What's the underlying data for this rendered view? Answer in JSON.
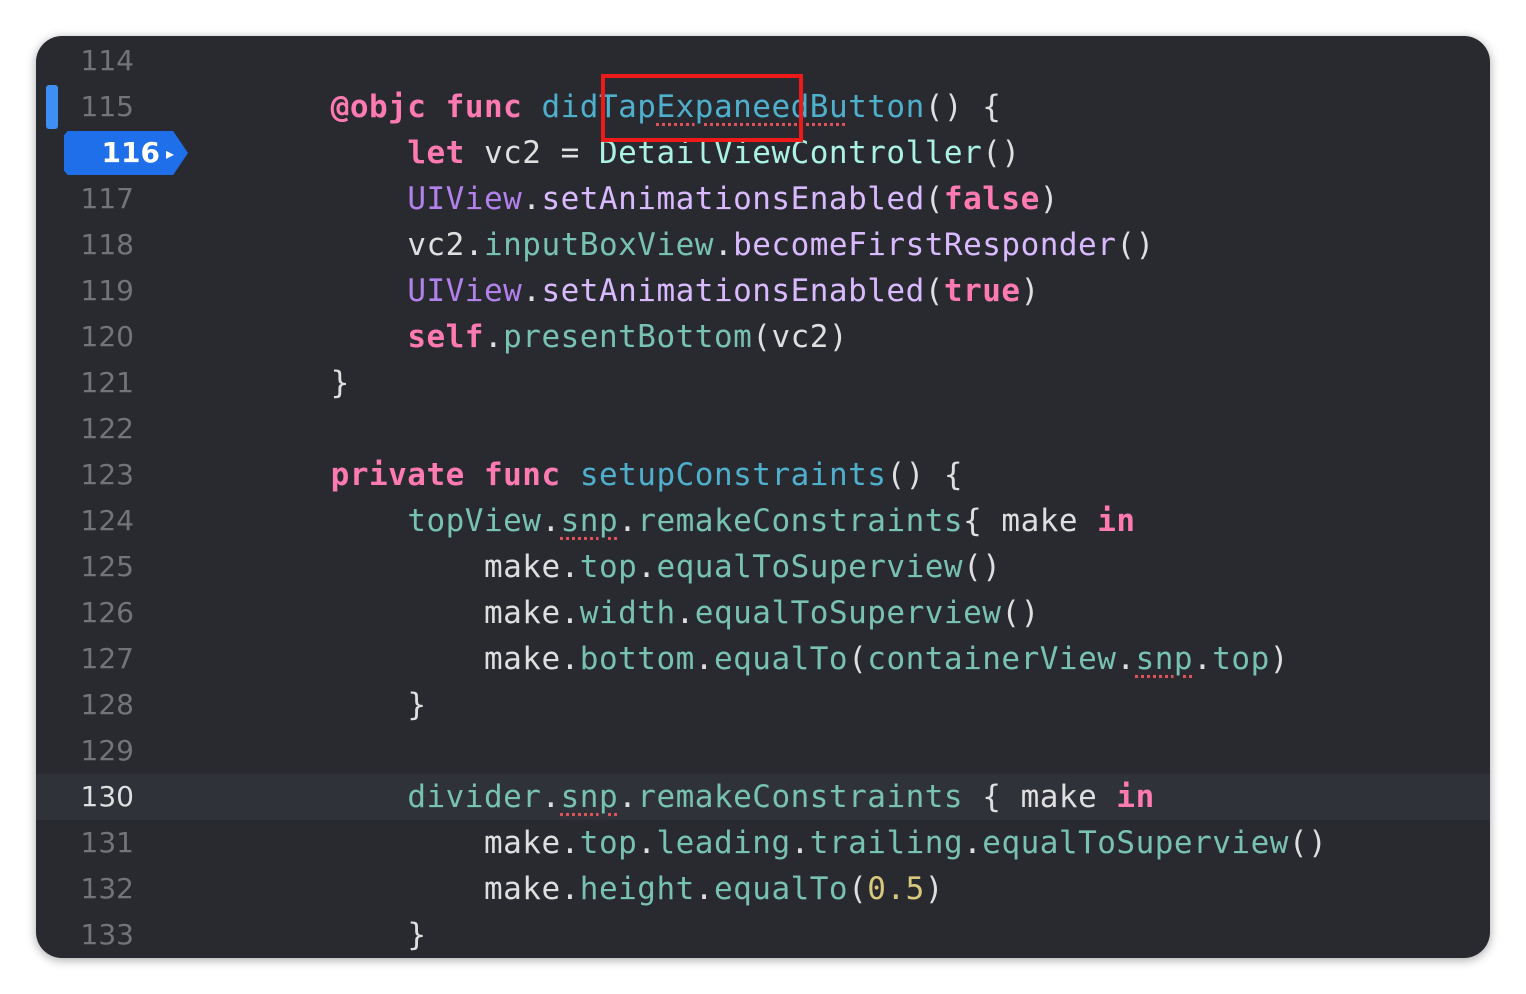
{
  "editor": {
    "current_line": 130,
    "breakpoint": {
      "line": "116",
      "arrow": "▸"
    },
    "lines": [
      {
        "n": "114",
        "tokens": []
      },
      {
        "n": "115",
        "indent": "    ",
        "tokens": [
          [
            "kw",
            "@objc"
          ],
          [
            "plain",
            " "
          ],
          [
            "kw",
            "func"
          ],
          [
            "plain",
            " "
          ],
          [
            "decl",
            "didTapExpaneedButton",
            "warn-part"
          ],
          [
            "plain",
            "() {"
          ]
        ]
      },
      {
        "n": "116",
        "indent": "        ",
        "tokens": [
          [
            "kw",
            "let"
          ],
          [
            "plain",
            " vc2 = "
          ],
          [
            "typ",
            "DetailViewController"
          ],
          [
            "plain",
            "()"
          ]
        ]
      },
      {
        "n": "117",
        "indent": "        ",
        "tokens": [
          [
            "ctype",
            "UIView"
          ],
          [
            "plain",
            "."
          ],
          [
            "cls",
            "setAnimationsEnabled"
          ],
          [
            "plain",
            "("
          ],
          [
            "kw",
            "false"
          ],
          [
            "plain",
            ")"
          ]
        ]
      },
      {
        "n": "118",
        "indent": "        ",
        "tokens": [
          [
            "plain",
            "vc2."
          ],
          [
            "mem",
            "inputBoxView"
          ],
          [
            "plain",
            "."
          ],
          [
            "cls",
            "becomeFirstResponder"
          ],
          [
            "plain",
            "()"
          ]
        ]
      },
      {
        "n": "119",
        "indent": "        ",
        "tokens": [
          [
            "ctype",
            "UIView"
          ],
          [
            "plain",
            "."
          ],
          [
            "cls",
            "setAnimationsEnabled"
          ],
          [
            "plain",
            "("
          ],
          [
            "kw",
            "true"
          ],
          [
            "plain",
            ")"
          ]
        ]
      },
      {
        "n": "120",
        "indent": "        ",
        "tokens": [
          [
            "kw",
            "self"
          ],
          [
            "plain",
            "."
          ],
          [
            "mem",
            "presentBottom"
          ],
          [
            "plain",
            "(vc2)"
          ]
        ]
      },
      {
        "n": "121",
        "indent": "    ",
        "tokens": [
          [
            "plain",
            "}"
          ]
        ]
      },
      {
        "n": "122",
        "tokens": []
      },
      {
        "n": "123",
        "indent": "    ",
        "tokens": [
          [
            "kw",
            "private"
          ],
          [
            "plain",
            " "
          ],
          [
            "kw",
            "func"
          ],
          [
            "plain",
            " "
          ],
          [
            "decl",
            "setupConstraints"
          ],
          [
            "plain",
            "() {"
          ]
        ]
      },
      {
        "n": "124",
        "indent": "        ",
        "tokens": [
          [
            "mem",
            "topView"
          ],
          [
            "plain",
            "."
          ],
          [
            "mem",
            "snp",
            "warn"
          ],
          [
            "plain",
            "."
          ],
          [
            "mem",
            "remakeConstraints"
          ],
          [
            "plain",
            "{ make "
          ],
          [
            "kw",
            "in"
          ]
        ]
      },
      {
        "n": "125",
        "indent": "            ",
        "tokens": [
          [
            "plain",
            "make."
          ],
          [
            "mem",
            "top"
          ],
          [
            "plain",
            "."
          ],
          [
            "mem",
            "equalToSuperview"
          ],
          [
            "plain",
            "()"
          ]
        ]
      },
      {
        "n": "126",
        "indent": "            ",
        "tokens": [
          [
            "plain",
            "make."
          ],
          [
            "mem",
            "width"
          ],
          [
            "plain",
            "."
          ],
          [
            "mem",
            "equalToSuperview"
          ],
          [
            "plain",
            "()"
          ]
        ]
      },
      {
        "n": "127",
        "indent": "            ",
        "tokens": [
          [
            "plain",
            "make."
          ],
          [
            "mem",
            "bottom"
          ],
          [
            "plain",
            "."
          ],
          [
            "mem",
            "equalTo"
          ],
          [
            "plain",
            "("
          ],
          [
            "mem",
            "containerView"
          ],
          [
            "plain",
            "."
          ],
          [
            "mem",
            "snp",
            "warn"
          ],
          [
            "plain",
            "."
          ],
          [
            "mem",
            "top"
          ],
          [
            "plain",
            ")"
          ]
        ]
      },
      {
        "n": "128",
        "indent": "        ",
        "tokens": [
          [
            "plain",
            "}"
          ]
        ]
      },
      {
        "n": "129",
        "tokens": []
      },
      {
        "n": "130",
        "indent": "        ",
        "tokens": [
          [
            "mem",
            "divider"
          ],
          [
            "plain",
            "."
          ],
          [
            "mem",
            "snp",
            "warn"
          ],
          [
            "plain",
            "."
          ],
          [
            "mem",
            "remakeConstraints"
          ],
          [
            "plain",
            " { make "
          ],
          [
            "kw",
            "in"
          ]
        ]
      },
      {
        "n": "131",
        "indent": "            ",
        "tokens": [
          [
            "plain",
            "make."
          ],
          [
            "mem",
            "top"
          ],
          [
            "plain",
            "."
          ],
          [
            "mem",
            "leading"
          ],
          [
            "plain",
            "."
          ],
          [
            "mem",
            "trailing"
          ],
          [
            "plain",
            "."
          ],
          [
            "mem",
            "equalToSuperview"
          ],
          [
            "plain",
            "()"
          ]
        ]
      },
      {
        "n": "132",
        "indent": "            ",
        "tokens": [
          [
            "plain",
            "make."
          ],
          [
            "mem",
            "height"
          ],
          [
            "plain",
            "."
          ],
          [
            "mem",
            "equalTo"
          ],
          [
            "plain",
            "("
          ],
          [
            "num",
            "0.5"
          ],
          [
            "plain",
            ")"
          ]
        ]
      },
      {
        "n": "133",
        "indent": "        ",
        "tokens": [
          [
            "plain",
            "}"
          ]
        ]
      }
    ]
  },
  "colors": {
    "background": "#292a30",
    "keyword": "#ff7ab2",
    "declaration": "#4eb0cc",
    "type": "#acf2e4",
    "other_class": "#dabaff",
    "member": "#78c2b3",
    "number": "#d9c97c",
    "plain": "#dfdfe0",
    "breakpoint": "#1f6fea",
    "annotation_box": "#ee1a1a"
  }
}
